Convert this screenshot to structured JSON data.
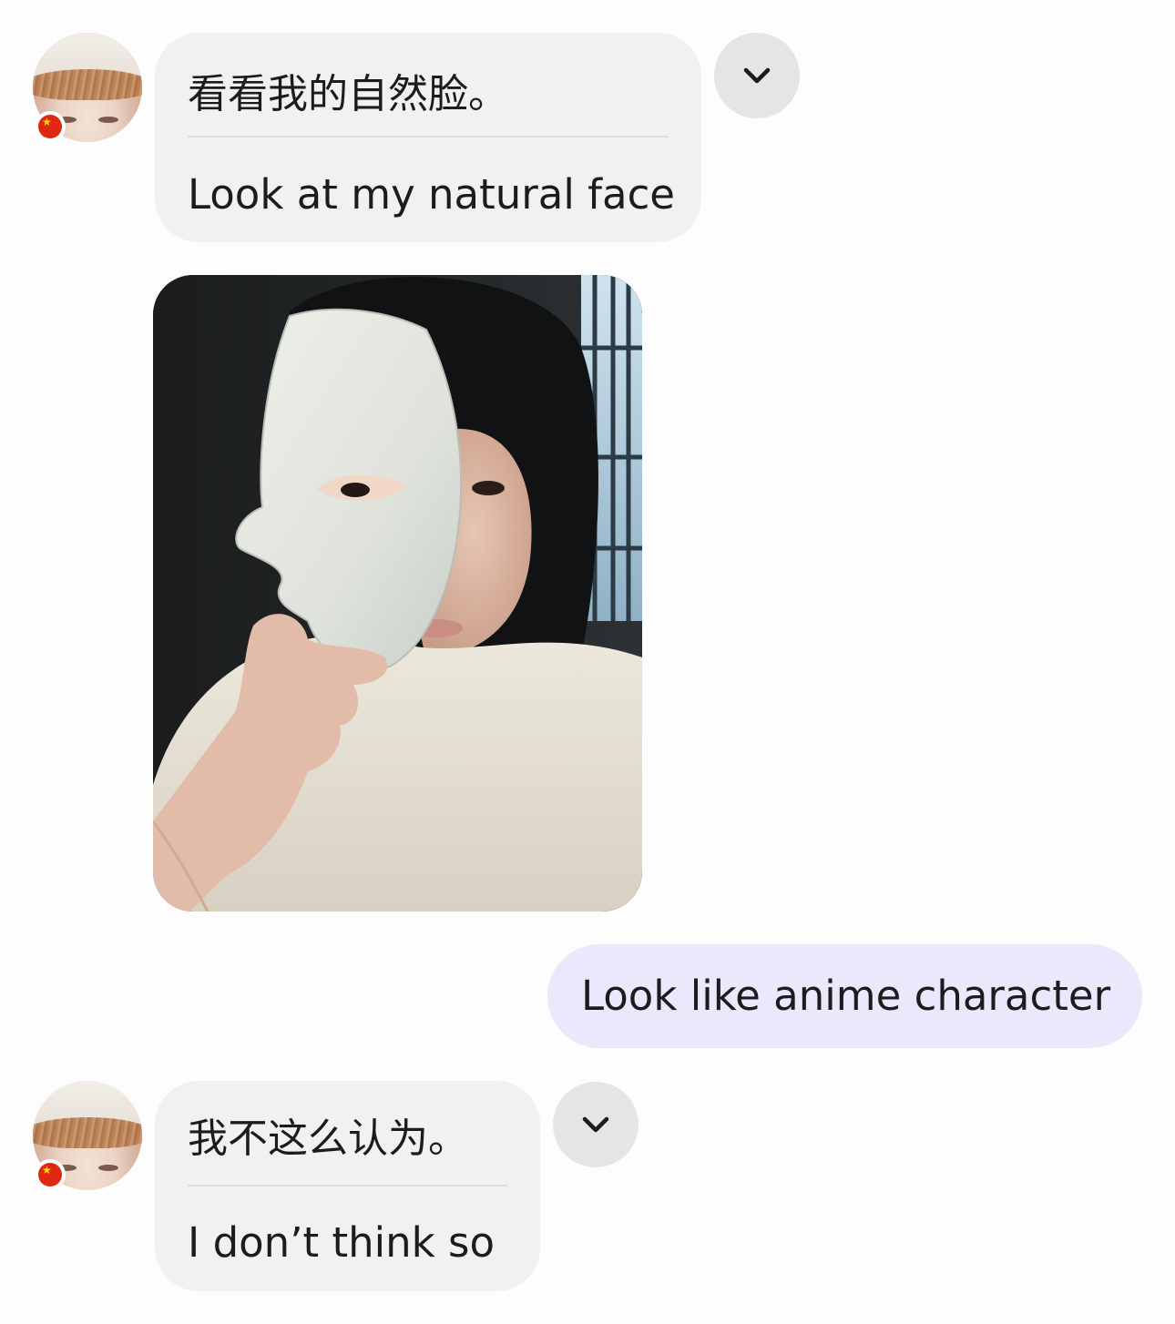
{
  "messages": [
    {
      "sender": "incoming",
      "original": "看看我的自然脸。",
      "translation": "Look at my natural face",
      "avatar_badge": "china-flag-icon"
    },
    {
      "sender": "incoming",
      "attachment": "photo"
    },
    {
      "sender": "outgoing",
      "text": "Look like anime character"
    },
    {
      "sender": "incoming",
      "original": "我不这么认为。",
      "translation": "I don’t think so",
      "avatar_badge": "china-flag-icon"
    }
  ],
  "icons": {
    "expand": "chevron-down-icon",
    "flag": "china-flag-icon"
  },
  "colors": {
    "incoming_bubble": "#f1f1f1",
    "outgoing_bubble": "#ebe8fb",
    "chevron_button": "#e5e5e5",
    "background": "#fdfdfd"
  }
}
